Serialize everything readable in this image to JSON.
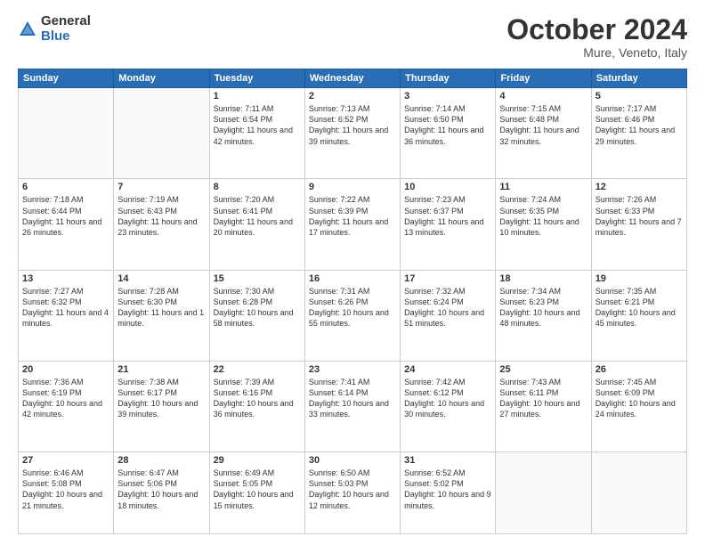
{
  "logo": {
    "general": "General",
    "blue": "Blue"
  },
  "title": "October 2024",
  "subtitle": "Mure, Veneto, Italy",
  "headers": [
    "Sunday",
    "Monday",
    "Tuesday",
    "Wednesday",
    "Thursday",
    "Friday",
    "Saturday"
  ],
  "weeks": [
    [
      {
        "day": "",
        "info": ""
      },
      {
        "day": "",
        "info": ""
      },
      {
        "day": "1",
        "info": "Sunrise: 7:11 AM\nSunset: 6:54 PM\nDaylight: 11 hours and 42 minutes."
      },
      {
        "day": "2",
        "info": "Sunrise: 7:13 AM\nSunset: 6:52 PM\nDaylight: 11 hours and 39 minutes."
      },
      {
        "day": "3",
        "info": "Sunrise: 7:14 AM\nSunset: 6:50 PM\nDaylight: 11 hours and 36 minutes."
      },
      {
        "day": "4",
        "info": "Sunrise: 7:15 AM\nSunset: 6:48 PM\nDaylight: 11 hours and 32 minutes."
      },
      {
        "day": "5",
        "info": "Sunrise: 7:17 AM\nSunset: 6:46 PM\nDaylight: 11 hours and 29 minutes."
      }
    ],
    [
      {
        "day": "6",
        "info": "Sunrise: 7:18 AM\nSunset: 6:44 PM\nDaylight: 11 hours and 26 minutes."
      },
      {
        "day": "7",
        "info": "Sunrise: 7:19 AM\nSunset: 6:43 PM\nDaylight: 11 hours and 23 minutes."
      },
      {
        "day": "8",
        "info": "Sunrise: 7:20 AM\nSunset: 6:41 PM\nDaylight: 11 hours and 20 minutes."
      },
      {
        "day": "9",
        "info": "Sunrise: 7:22 AM\nSunset: 6:39 PM\nDaylight: 11 hours and 17 minutes."
      },
      {
        "day": "10",
        "info": "Sunrise: 7:23 AM\nSunset: 6:37 PM\nDaylight: 11 hours and 13 minutes."
      },
      {
        "day": "11",
        "info": "Sunrise: 7:24 AM\nSunset: 6:35 PM\nDaylight: 11 hours and 10 minutes."
      },
      {
        "day": "12",
        "info": "Sunrise: 7:26 AM\nSunset: 6:33 PM\nDaylight: 11 hours and 7 minutes."
      }
    ],
    [
      {
        "day": "13",
        "info": "Sunrise: 7:27 AM\nSunset: 6:32 PM\nDaylight: 11 hours and 4 minutes."
      },
      {
        "day": "14",
        "info": "Sunrise: 7:28 AM\nSunset: 6:30 PM\nDaylight: 11 hours and 1 minute."
      },
      {
        "day": "15",
        "info": "Sunrise: 7:30 AM\nSunset: 6:28 PM\nDaylight: 10 hours and 58 minutes."
      },
      {
        "day": "16",
        "info": "Sunrise: 7:31 AM\nSunset: 6:26 PM\nDaylight: 10 hours and 55 minutes."
      },
      {
        "day": "17",
        "info": "Sunrise: 7:32 AM\nSunset: 6:24 PM\nDaylight: 10 hours and 51 minutes."
      },
      {
        "day": "18",
        "info": "Sunrise: 7:34 AM\nSunset: 6:23 PM\nDaylight: 10 hours and 48 minutes."
      },
      {
        "day": "19",
        "info": "Sunrise: 7:35 AM\nSunset: 6:21 PM\nDaylight: 10 hours and 45 minutes."
      }
    ],
    [
      {
        "day": "20",
        "info": "Sunrise: 7:36 AM\nSunset: 6:19 PM\nDaylight: 10 hours and 42 minutes."
      },
      {
        "day": "21",
        "info": "Sunrise: 7:38 AM\nSunset: 6:17 PM\nDaylight: 10 hours and 39 minutes."
      },
      {
        "day": "22",
        "info": "Sunrise: 7:39 AM\nSunset: 6:16 PM\nDaylight: 10 hours and 36 minutes."
      },
      {
        "day": "23",
        "info": "Sunrise: 7:41 AM\nSunset: 6:14 PM\nDaylight: 10 hours and 33 minutes."
      },
      {
        "day": "24",
        "info": "Sunrise: 7:42 AM\nSunset: 6:12 PM\nDaylight: 10 hours and 30 minutes."
      },
      {
        "day": "25",
        "info": "Sunrise: 7:43 AM\nSunset: 6:11 PM\nDaylight: 10 hours and 27 minutes."
      },
      {
        "day": "26",
        "info": "Sunrise: 7:45 AM\nSunset: 6:09 PM\nDaylight: 10 hours and 24 minutes."
      }
    ],
    [
      {
        "day": "27",
        "info": "Sunrise: 6:46 AM\nSunset: 5:08 PM\nDaylight: 10 hours and 21 minutes."
      },
      {
        "day": "28",
        "info": "Sunrise: 6:47 AM\nSunset: 5:06 PM\nDaylight: 10 hours and 18 minutes."
      },
      {
        "day": "29",
        "info": "Sunrise: 6:49 AM\nSunset: 5:05 PM\nDaylight: 10 hours and 15 minutes."
      },
      {
        "day": "30",
        "info": "Sunrise: 6:50 AM\nSunset: 5:03 PM\nDaylight: 10 hours and 12 minutes."
      },
      {
        "day": "31",
        "info": "Sunrise: 6:52 AM\nSunset: 5:02 PM\nDaylight: 10 hours and 9 minutes."
      },
      {
        "day": "",
        "info": ""
      },
      {
        "day": "",
        "info": ""
      }
    ]
  ]
}
